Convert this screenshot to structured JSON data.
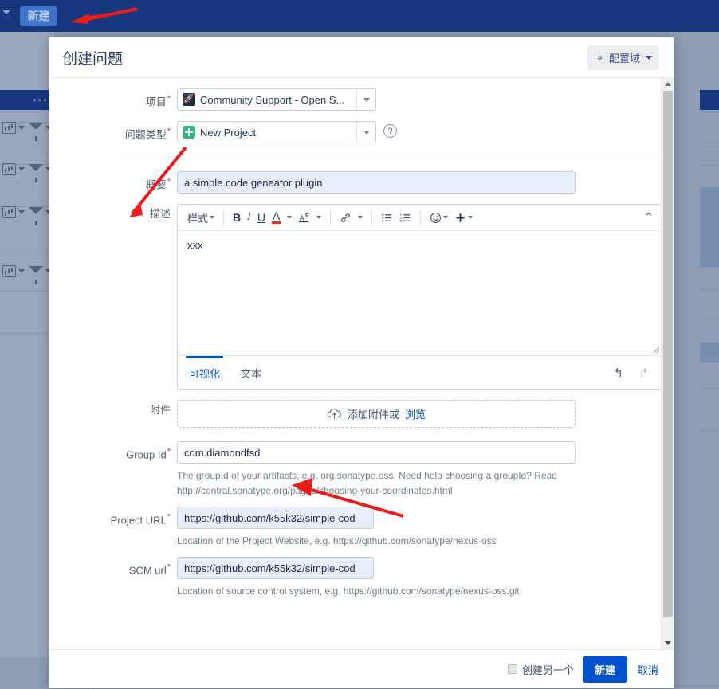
{
  "background": {
    "new_button_label": "新建",
    "nav_caret_icon": "chevron-down-icon",
    "dots_icon": "ellipsis-icon",
    "dots_label": "•••",
    "chart_icon": "bar-chart-icon",
    "filter_icon": "filter-icon"
  },
  "dialog": {
    "title": "创建问题",
    "config_button": {
      "label": "配置域",
      "icon": "gear-icon",
      "caret_icon": "chevron-down-icon"
    },
    "fields": {
      "project": {
        "label": "项目",
        "required": true,
        "value": "Community Support - Open S...",
        "icon": "rocket-project-icon",
        "caret_icon": "chevron-down-icon"
      },
      "issue_type": {
        "label": "问题类型",
        "required": true,
        "value": "New Project",
        "icon": "green-plus-icon",
        "caret_icon": "chevron-down-icon",
        "help_icon": "question-mark-icon",
        "help_glyph": "?"
      },
      "summary": {
        "label": "概要",
        "required": true,
        "value": "a simple code geneator plugin"
      },
      "description": {
        "label": "描述",
        "required": false,
        "content": "xxx",
        "toolbar": {
          "style_label": "样式",
          "bold_label": "B",
          "italic_label": "I",
          "underline_label": "U",
          "text_color_label": "A",
          "text_color_accent": "#de350b",
          "highlight_label": "A",
          "link_icon": "link-icon",
          "bullet_list_icon": "bullet-list-icon",
          "numbered_list_icon": "numbered-list-icon",
          "emoji_icon": "emoji-icon",
          "emoji_glyph": "☺",
          "plus_icon": "plus-icon",
          "plus_glyph": "+",
          "collapse_icon": "chevron-up-icon",
          "collapse_glyph": "⌃"
        },
        "tabs": [
          {
            "label": "可视化",
            "active": true
          },
          {
            "label": "文本",
            "active": false
          }
        ],
        "undo_icon": "undo-icon",
        "undo_glyph": "↰",
        "redo_icon": "redo-icon",
        "redo_glyph": "↱",
        "resize_handle_icon": "resize-grip-icon"
      },
      "attachment": {
        "label": "附件",
        "required": false,
        "upload_icon": "cloud-upload-icon",
        "prompt": "添加附件或",
        "browse_link": "浏览",
        "trailing": "."
      },
      "group_id": {
        "label": "Group Id",
        "required": true,
        "value": "com.diamondfsd",
        "help": "The groupId of your artifacts, e.g. org.sonatype.oss. Need help choosing a groupId? Read http://central.sonatype.org/pages/choosing-your-coordinates.html"
      },
      "project_url": {
        "label": "Project URL",
        "required": true,
        "value": "https://github.com/k55k32/simple-cod",
        "help": "Location of the Project Website, e.g. https://github.com/sonatype/nexus-oss"
      },
      "scm_url": {
        "label": "SCM url",
        "required": true,
        "value": "https://github.com/k55k32/simple-cod",
        "help": "Location of source control system, e.g. https://github.com/sonatype/nexus-oss.git"
      }
    },
    "footer": {
      "create_another_label": "创建另一个",
      "create_another_checked": false,
      "submit_label": "新建",
      "cancel_label": "取消"
    },
    "scrollbar": {
      "up_arrow_icon": "scroll-up-arrow-icon",
      "down_arrow_icon": "scroll-down-arrow-icon",
      "thumb_icon": "scrollbar-thumb"
    }
  },
  "annotations": {
    "arrow_color": "#ee1c19",
    "arrows": [
      {
        "name": "arrow-to-new-button"
      },
      {
        "name": "arrow-to-issue-type"
      },
      {
        "name": "arrow-to-group-id"
      }
    ]
  },
  "colors": {
    "nav_blue": "#17377f",
    "primary_blue": "#0052cc",
    "required_red": "#d04437",
    "overlay": "#8e9cb4"
  }
}
